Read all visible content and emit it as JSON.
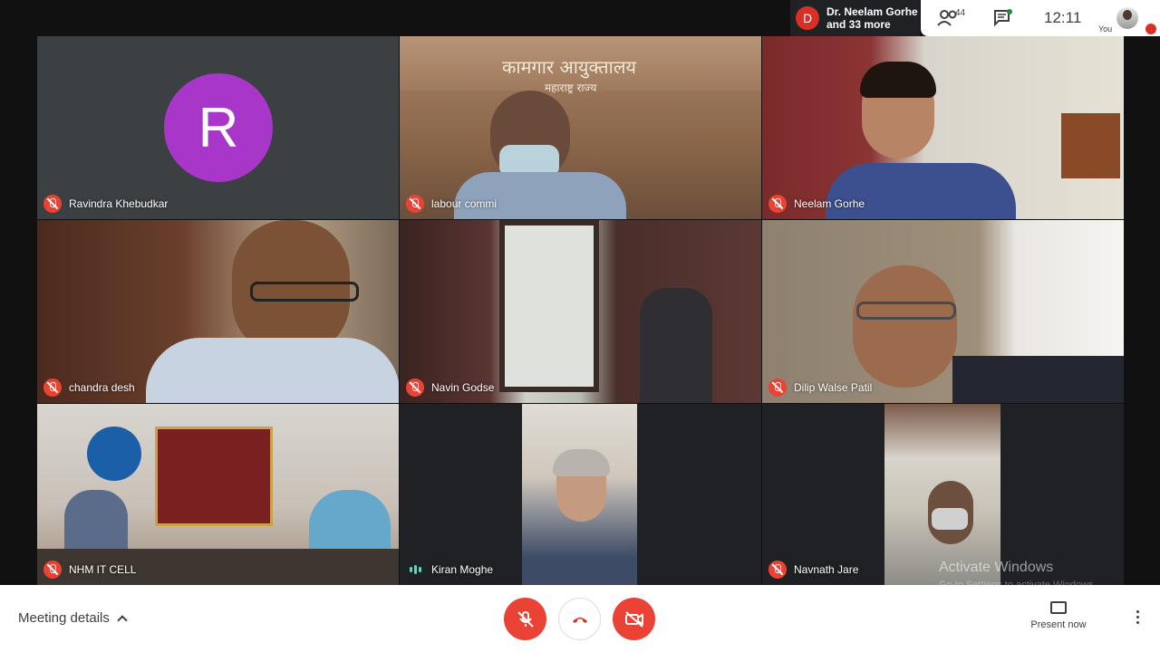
{
  "header": {
    "presenter_initial": "D",
    "presenter_line1": "Dr. Neelam Gorhe",
    "presenter_line2": "and 33 more",
    "participant_count": "44",
    "time": "12:11",
    "you_label": "You"
  },
  "tiles": [
    {
      "name": "Ravindra Khebudkar",
      "avatar_letter": "R",
      "muted": true
    },
    {
      "name": "labour commi",
      "muted": true,
      "sign_line1": "कामगार आयुक्तालय",
      "sign_line2": "महाराष्ट्र राज्य"
    },
    {
      "name": "Neelam Gorhe",
      "muted": true
    },
    {
      "name": "chandra desh",
      "muted": true
    },
    {
      "name": "Navin Godse",
      "muted": true
    },
    {
      "name": "Dilip Walse Patil",
      "muted": true
    },
    {
      "name": "NHM IT CELL",
      "muted": true
    },
    {
      "name": "Kiran Moghe",
      "muted": false,
      "speaking": true
    },
    {
      "name": "Navnath Jare",
      "muted": true
    }
  ],
  "watermark": {
    "line1": "Activate Windows",
    "line2": "Go to Settings to activate Windows."
  },
  "controls": {
    "meeting_details": "Meeting details",
    "present_now": "Present now"
  },
  "colors": {
    "danger": "#ea4335",
    "avatar_purple": "#a837c9",
    "speaking": "#62d5c3"
  }
}
